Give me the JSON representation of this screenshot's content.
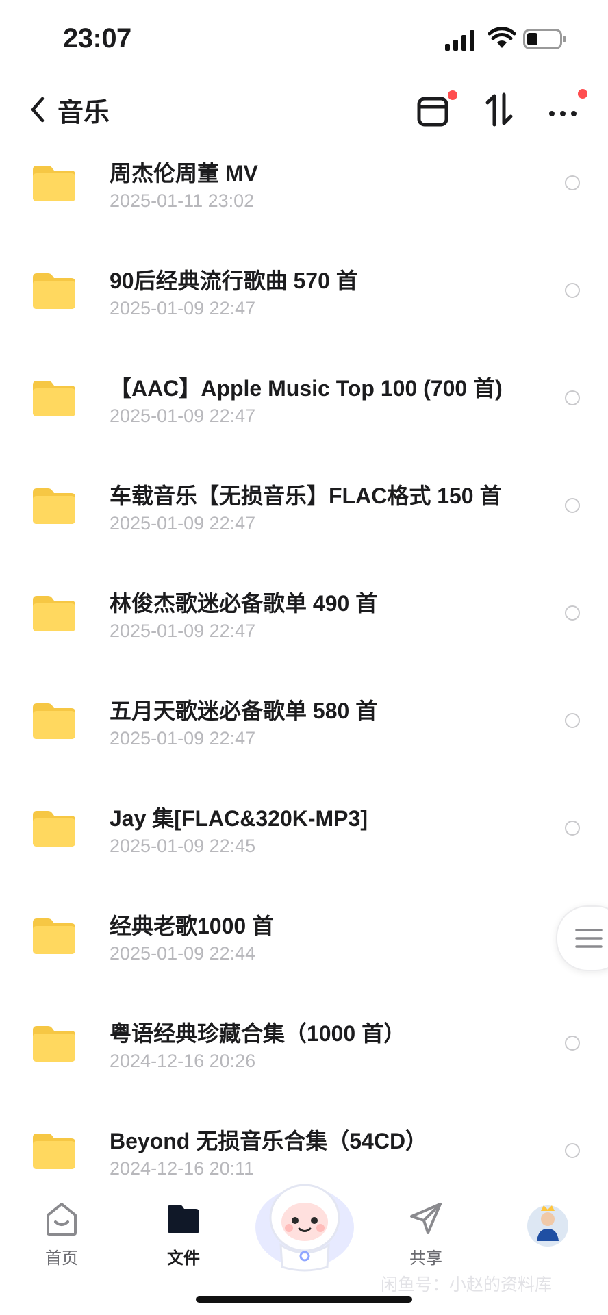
{
  "status_bar": {
    "time": "23:07"
  },
  "nav": {
    "title": "音乐"
  },
  "files": [
    {
      "name": "周杰伦周董 MV",
      "date": "2025-01-11 23:02"
    },
    {
      "name": "90后经典流行歌曲 570 首",
      "date": "2025-01-09 22:47"
    },
    {
      "name": "【AAC】Apple Music Top 100 (700 首)",
      "date": "2025-01-09 22:47"
    },
    {
      "name": "车载音乐【无损音乐】FLAC格式 150 首",
      "date": "2025-01-09 22:47"
    },
    {
      "name": "林俊杰歌迷必备歌单 490 首",
      "date": "2025-01-09 22:47"
    },
    {
      "name": "五月天歌迷必备歌单 580 首",
      "date": "2025-01-09 22:47"
    },
    {
      "name": "Jay 集[FLAC&320K-MP3]",
      "date": "2025-01-09 22:45"
    },
    {
      "name": "经典老歌1000 首",
      "date": "2025-01-09 22:44"
    },
    {
      "name": "粤语经典珍藏合集（1000 首）",
      "date": "2024-12-16 20:26"
    },
    {
      "name": "Beyond 无损音乐合集（54CD）",
      "date": "2024-12-16 20:11"
    }
  ],
  "tabs": [
    {
      "label": "首页",
      "icon": "home-smile-icon",
      "active": false
    },
    {
      "label": "文件",
      "icon": "folder-filled-icon",
      "active": true
    },
    {
      "label": "共享",
      "icon": "send-icon",
      "active": false
    }
  ],
  "watermark": "闲鱼号：小赵的资料库",
  "colors": {
    "folder": "#ffd45c",
    "notification_dot": "#ff4d4f",
    "secondary_text": "#b8b8bc"
  }
}
